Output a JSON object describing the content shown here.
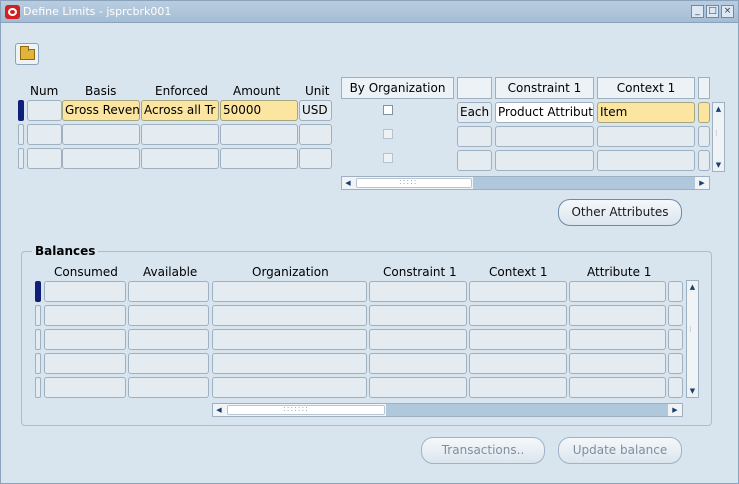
{
  "window": {
    "title": "Define Limits - jsprcbrk001"
  },
  "toolbar": {
    "open_icon": "folder-open-icon"
  },
  "limits": {
    "headers": {
      "num": "Num",
      "basis": "Basis",
      "enforced": "Enforced",
      "amount": "Amount",
      "unit": "Unit",
      "by_org": "By Organization",
      "constraint1": "Constraint 1",
      "context1": "Context 1"
    },
    "rows": [
      {
        "num": "",
        "basis": "Gross Reven",
        "enforced": "Across all Tr",
        "amount": "50000",
        "unit": "USD",
        "by_org": false,
        "each": "Each",
        "constraint1": "Product Attribute",
        "context1": "Item"
      },
      {
        "num": "",
        "basis": "",
        "enforced": "",
        "amount": "",
        "unit": "",
        "by_org": false,
        "each": "",
        "constraint1": "",
        "context1": ""
      },
      {
        "num": "",
        "basis": "",
        "enforced": "",
        "amount": "",
        "unit": "",
        "by_org": false,
        "each": "",
        "constraint1": "",
        "context1": ""
      }
    ]
  },
  "buttons": {
    "other_attributes": "Other Attributes",
    "transactions": "Transactions..",
    "update_balance": "Update balance"
  },
  "balances": {
    "title": "Balances",
    "headers": {
      "consumed": "Consumed",
      "available": "Available",
      "organization": "Organization",
      "constraint1": "Constraint 1",
      "context1": "Context 1",
      "attribute1": "Attribute 1"
    }
  },
  "colors": {
    "window_bg": "#d8e4ee",
    "active_field": "#fbe5a0",
    "title_text": "#ffffff",
    "row_indicator": "#0f1f7a"
  }
}
